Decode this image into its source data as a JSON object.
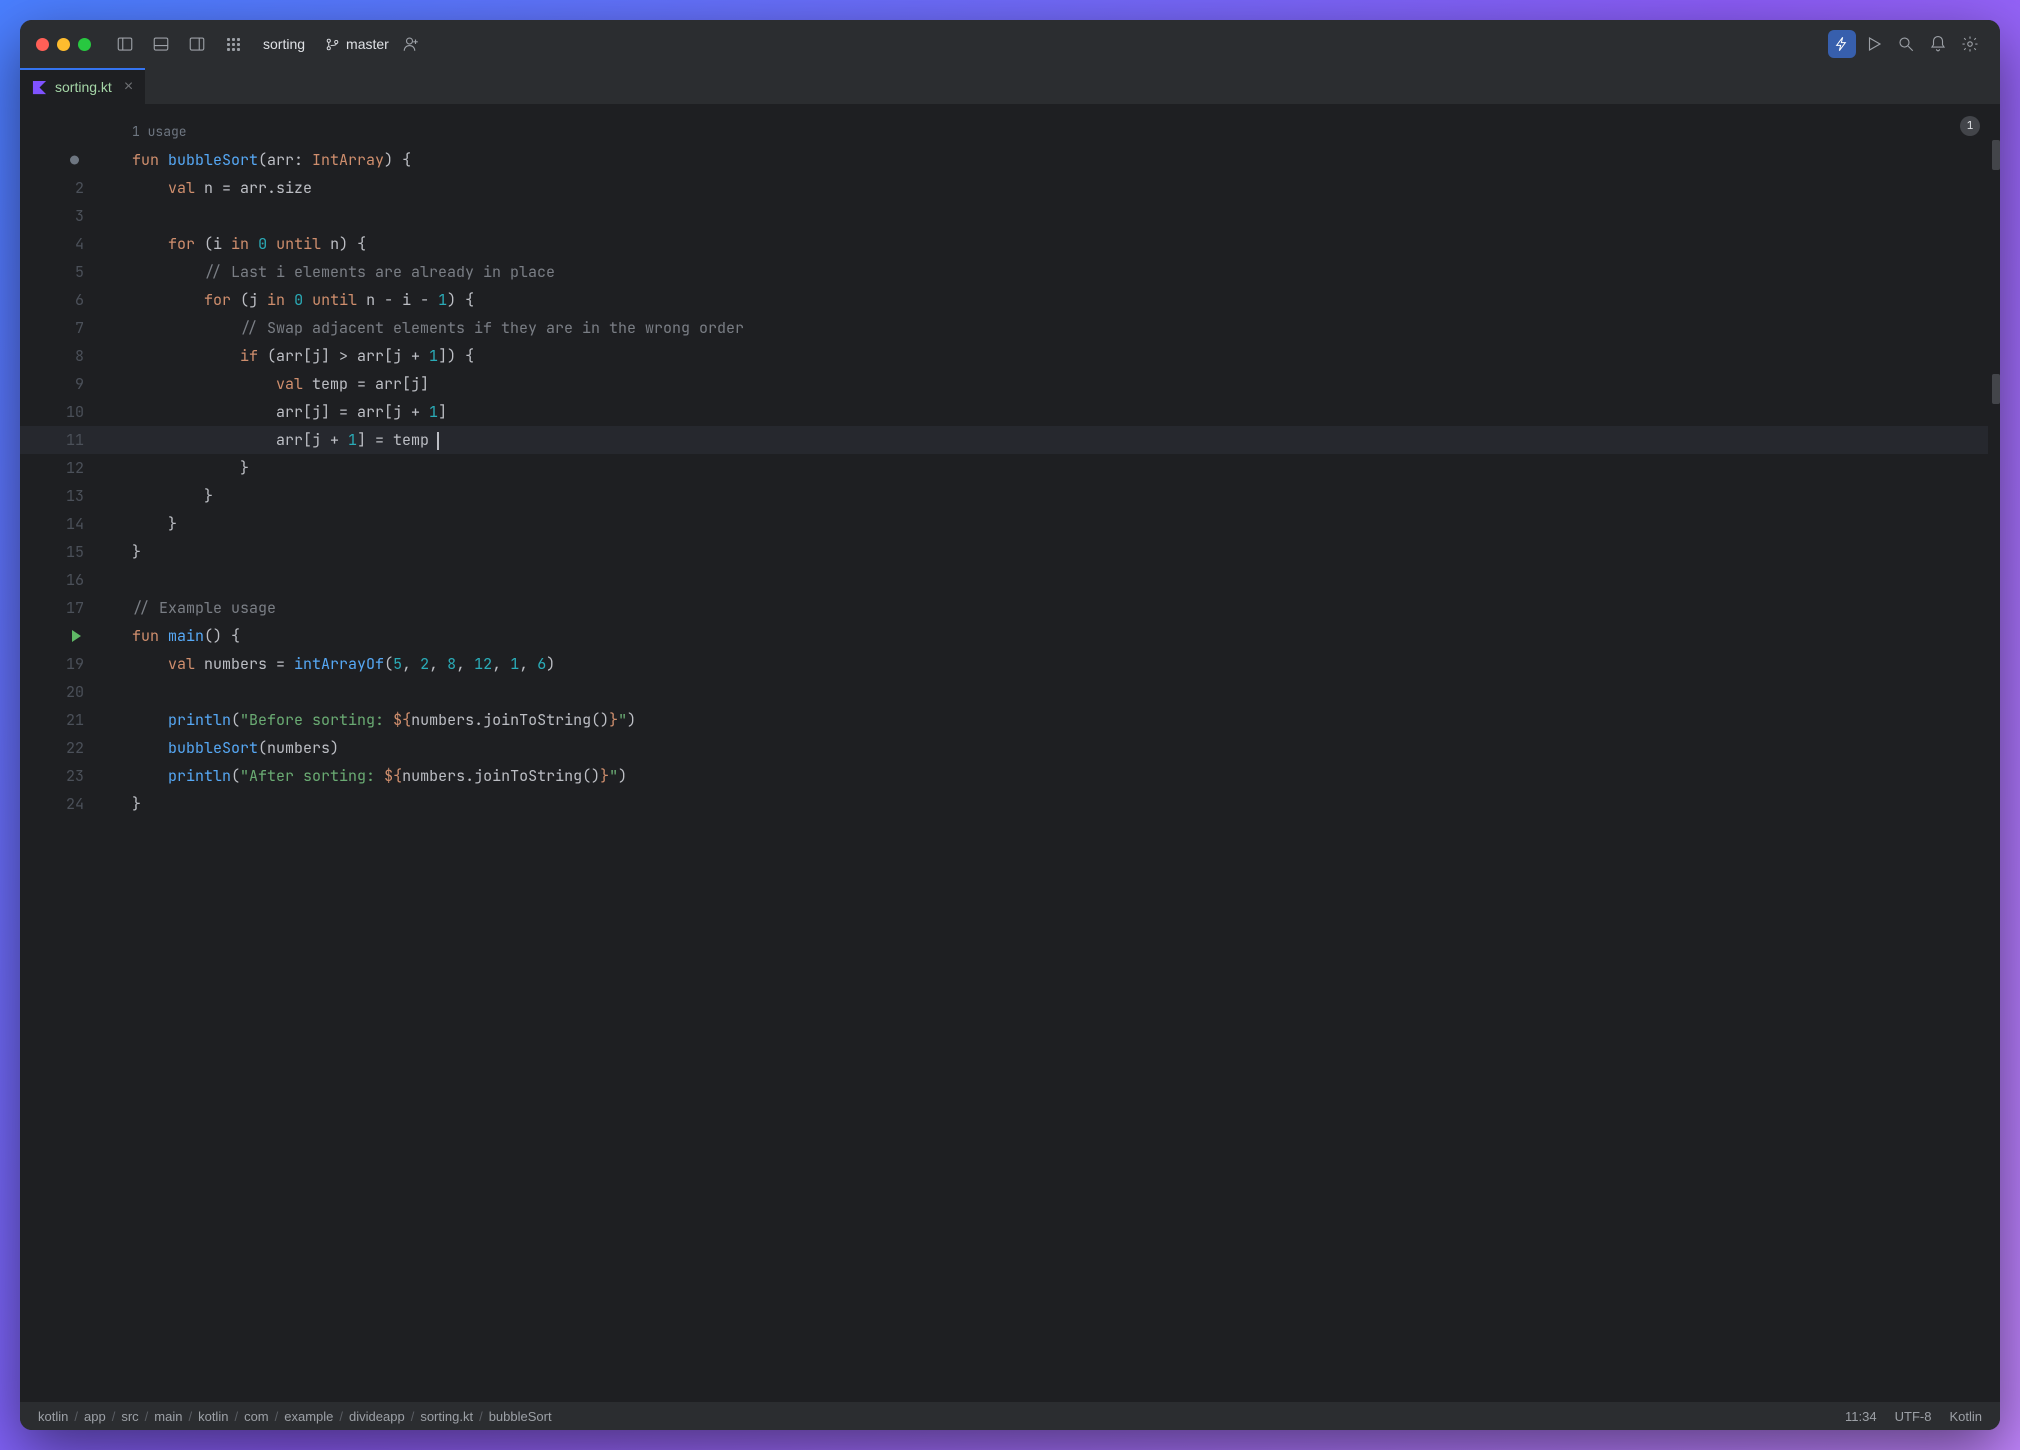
{
  "titlebar": {
    "project": "sorting",
    "branch": "master"
  },
  "tab": {
    "filename": "sorting.kt"
  },
  "usages_label": "1 usage",
  "problems_count": "1",
  "gutter_labels": [
    "",
    "2",
    "3",
    "4",
    "5",
    "6",
    "7",
    "8",
    "9",
    "10",
    "11",
    "12",
    "13",
    "14",
    "15",
    "16",
    "17",
    "",
    "19",
    "20",
    "21",
    "22",
    "23",
    "24"
  ],
  "code": {
    "l1_fun": "fun",
    "l1_name": " bubbleSort",
    "l1_rest": "(arr: ",
    "l1_type": "IntArray",
    "l1_end": ") {",
    "l2": "    val n = arr.size",
    "l2_kw": "val",
    "l2_rest": " n = arr.size",
    "l4_kw": "for",
    "l4_rest": " (i ",
    "l4_in": "in",
    "l4_mid": " ",
    "l4_n0": "0",
    "l4_until": " until",
    "l4_end": " n) {",
    "l5_cm": "// Last i elements are already in place",
    "l6_kw": "for",
    "l6_rest": " (j ",
    "l6_in": "in",
    "l6_mid": " ",
    "l6_n0": "0",
    "l6_until": " until",
    "l6_end": " n - i - ",
    "l6_n1": "1",
    "l6_end2": ") {",
    "l7_cm": "// Swap adjacent elements if they are in the wrong order",
    "l8_kw": "if",
    "l8_rest": " (arr[j] > arr[j + ",
    "l8_n1": "1",
    "l8_end": "]) {",
    "l9_kw": "val",
    "l9_rest": " temp = arr[j]",
    "l10": "arr[j] = arr[j + ",
    "l10_n1": "1",
    "l10_end": "]",
    "l11": "arr[j + ",
    "l11_n1": "1",
    "l11_end": "] = temp",
    "l12": "}",
    "l13": "}",
    "l14": "}",
    "l15": "}",
    "l17_cm": "// Example usage",
    "l18_fun": "fun",
    "l18_name": " main",
    "l18_end": "() {",
    "l19_kw": "val",
    "l19_rest": " numbers = ",
    "l19_fn": "intArrayOf",
    "l19_p": "(",
    "l19_n1": "5",
    "l19_c": ", ",
    "l19_n2": "2",
    "l19_n3": "8",
    "l19_n4": "12",
    "l19_n5": "1",
    "l19_n6": "6",
    "l19_e": ")",
    "l21_fn": "println",
    "l21_p": "(",
    "l21_s1": "\"Before sorting: ",
    "l21_i1": "${",
    "l21_v1": "numbers.joinToString()",
    "l21_i2": "}",
    "l21_s2": "\"",
    "l21_e": ")",
    "l22_fn": "bubbleSort",
    "l22_rest": "(numbers)",
    "l23_fn": "println",
    "l23_s1": "\"After sorting: ",
    "l23_v1": "numbers.joinToString()",
    "l24": "}"
  },
  "statusbar": {
    "path": [
      "kotlin",
      "app",
      "src",
      "main",
      "kotlin",
      "com",
      "example",
      "divideapp",
      "sorting.kt",
      "bubbleSort"
    ],
    "pos": "11:34",
    "encoding": "UTF-8",
    "lang": "Kotlin"
  }
}
